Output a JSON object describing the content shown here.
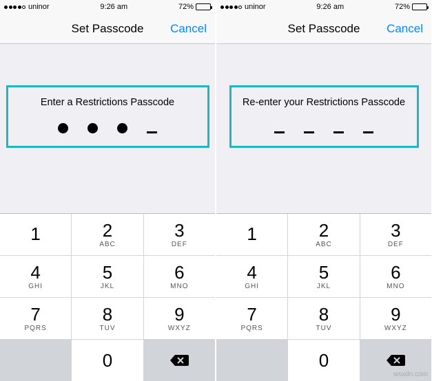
{
  "statusbar": {
    "carrier": "uninor",
    "time": "9:26 am",
    "battery_pct": "72%"
  },
  "nav": {
    "title": "Set Passcode",
    "cancel": "Cancel"
  },
  "left": {
    "prompt": "Enter a Restrictions Passcode",
    "filled_count": 3
  },
  "right": {
    "prompt": "Re-enter your Restrictions Passcode",
    "filled_count": 0
  },
  "keypad": [
    {
      "digit": "1",
      "letters": ""
    },
    {
      "digit": "2",
      "letters": "ABC"
    },
    {
      "digit": "3",
      "letters": "DEF"
    },
    {
      "digit": "4",
      "letters": "GHI"
    },
    {
      "digit": "5",
      "letters": "JKL"
    },
    {
      "digit": "6",
      "letters": "MNO"
    },
    {
      "digit": "7",
      "letters": "PQRS"
    },
    {
      "digit": "8",
      "letters": "TUV"
    },
    {
      "digit": "9",
      "letters": "WXYZ"
    },
    {
      "digit": "0",
      "letters": ""
    }
  ],
  "watermark": "wsxdn.com"
}
